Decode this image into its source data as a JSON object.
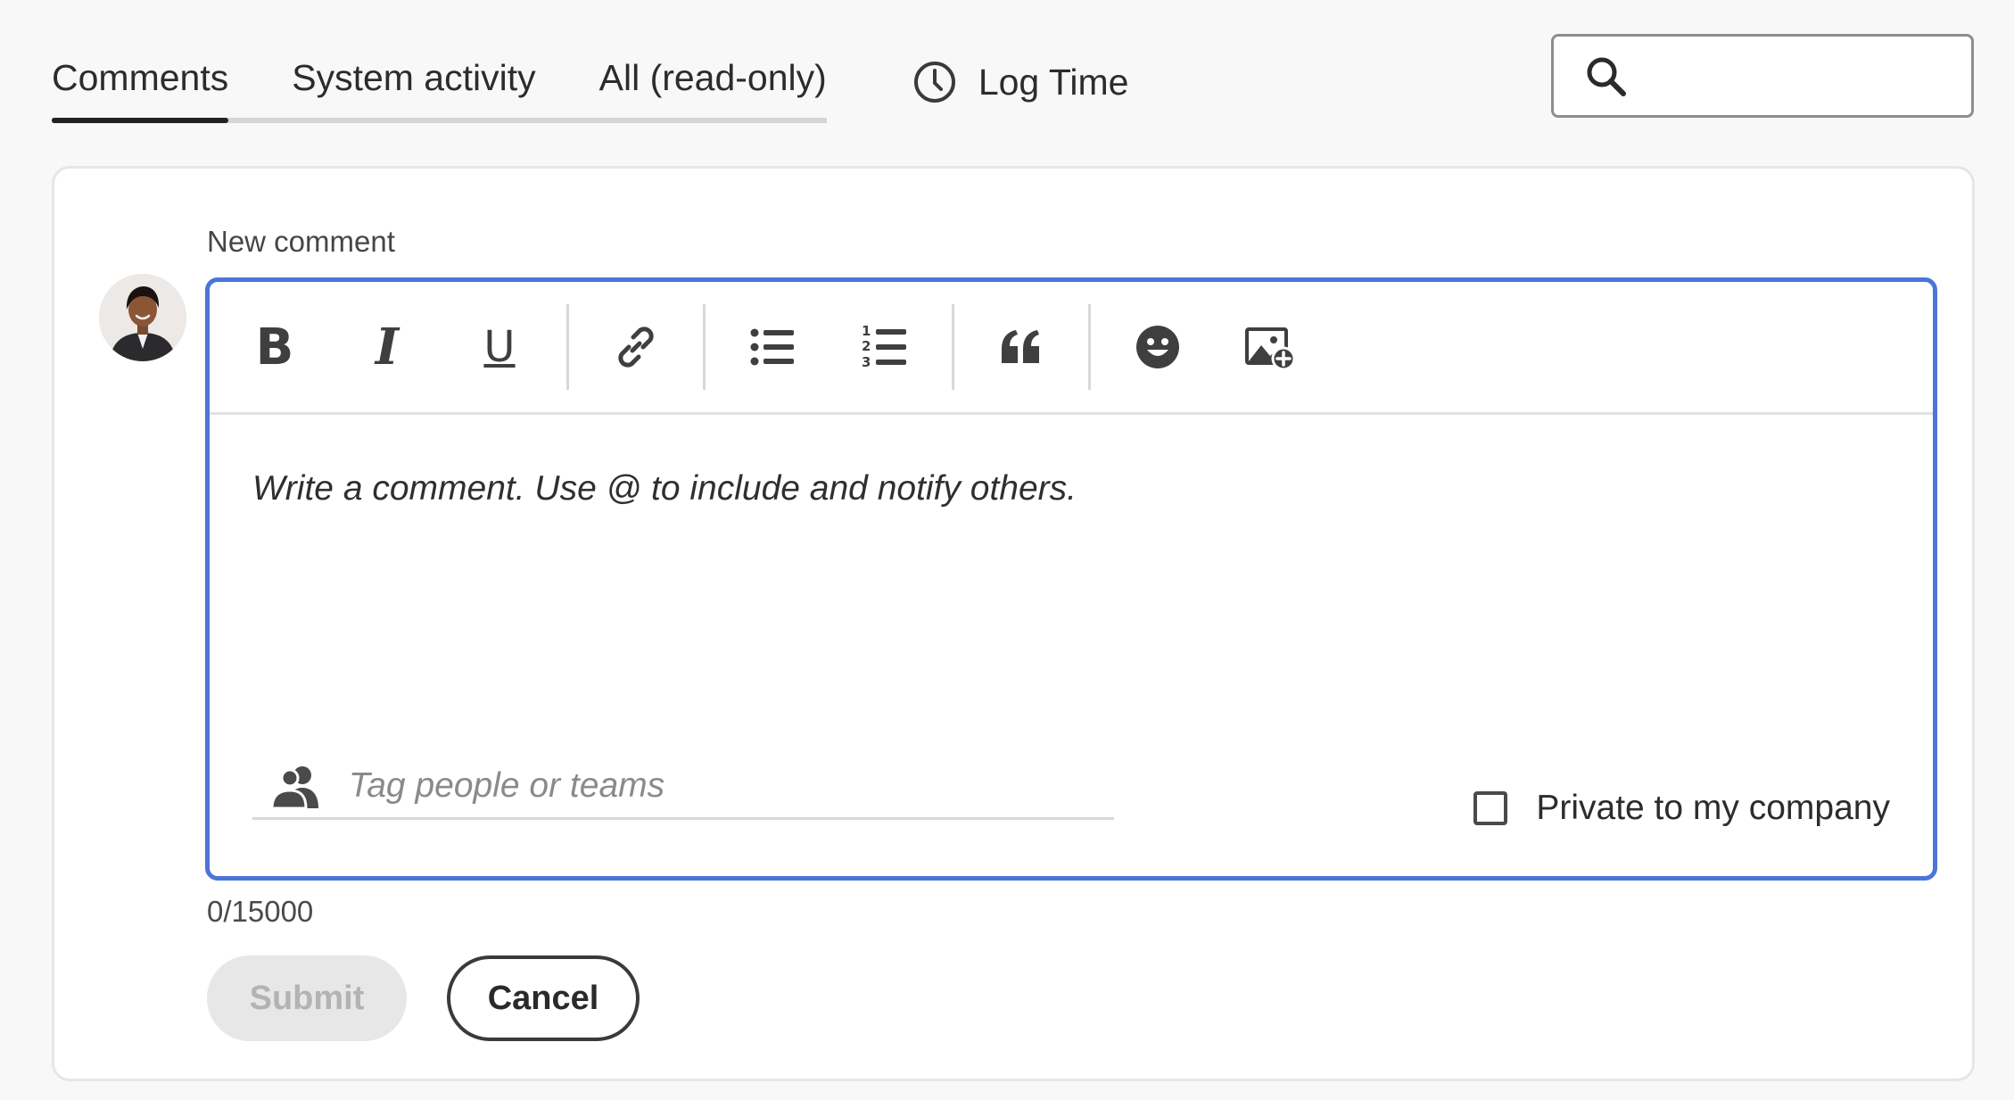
{
  "tabs": [
    {
      "label": "Comments",
      "active": true
    },
    {
      "label": "System activity",
      "active": false
    },
    {
      "label": "All (read-only)",
      "active": false
    }
  ],
  "log_time": {
    "label": "Log Time",
    "icon": "clock-icon"
  },
  "search": {
    "placeholder": "",
    "icon": "search-icon"
  },
  "comment": {
    "label": "New comment",
    "editor_placeholder": "Write a comment. Use @ to include and notify others.",
    "tag_placeholder": "Tag people or teams",
    "private_label": "Private to my company",
    "private_checked": false,
    "counter": "0/15000",
    "accent_color": "#4b75d9"
  },
  "toolbar": {
    "bold": "B",
    "italic": "I",
    "underline": "U",
    "icons": [
      "bold-icon",
      "italic-icon",
      "underline-icon",
      "link-icon",
      "bullet-list-icon",
      "numbered-list-icon",
      "quote-icon",
      "emoji-icon",
      "insert-image-icon"
    ]
  },
  "actions": {
    "submit": "Submit",
    "cancel": "Cancel"
  }
}
